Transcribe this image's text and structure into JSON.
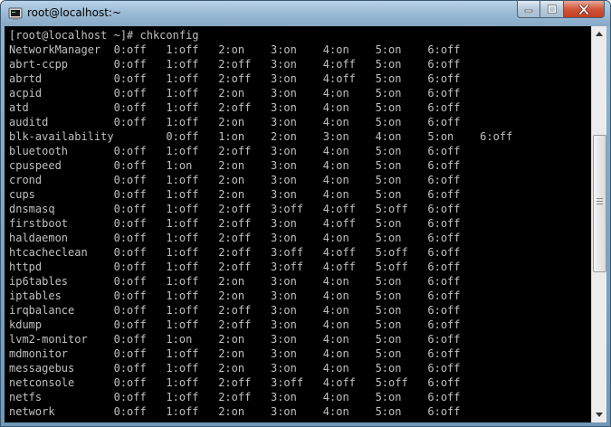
{
  "window": {
    "title": "root@localhost:~",
    "icon": "putty-terminal-icon"
  },
  "terminal": {
    "lines": [
      "[root@localhost ~]# chkconfig",
      "NetworkManager  0:off   1:off   2:on    3:on    4:on    5:on    6:off",
      "abrt-ccpp       0:off   1:off   2:off   3:on    4:off   5:on    6:off",
      "abrtd           0:off   1:off   2:off   3:on    4:off   5:on    6:off",
      "acpid           0:off   1:off   2:on    3:on    4:on    5:on    6:off",
      "atd             0:off   1:off   2:off   3:on    4:on    5:on    6:off",
      "auditd          0:off   1:off   2:on    3:on    4:on    5:on    6:off",
      "blk-availability        0:off   1:on    2:on    3:on    4:on    5:on    6:off",
      "bluetooth       0:off   1:off   2:off   3:on    4:on    5:on    6:off",
      "cpuspeed        0:off   1:on    2:on    3:on    4:on    5:on    6:off",
      "crond           0:off   1:off   2:on    3:on    4:on    5:on    6:off",
      "cups            0:off   1:off   2:on    3:on    4:on    5:on    6:off",
      "dnsmasq         0:off   1:off   2:off   3:off   4:off   5:off   6:off",
      "firstboot       0:off   1:off   2:off   3:on    4:off   5:on    6:off",
      "haldaemon       0:off   1:off   2:off   3:on    4:on    5:on    6:off",
      "htcacheclean    0:off   1:off   2:off   3:off   4:off   5:off   6:off",
      "httpd           0:off   1:off   2:off   3:off   4:off   5:off   6:off",
      "ip6tables       0:off   1:off   2:on    3:on    4:on    5:on    6:off",
      "iptables        0:off   1:off   2:on    3:on    4:on    5:on    6:off",
      "irqbalance      0:off   1:off   2:off   3:on    4:on    5:on    6:off",
      "kdump           0:off   1:off   2:off   3:on    4:on    5:on    6:off",
      "lvm2-monitor    0:off   1:on    2:on    3:on    4:on    5:on    6:off",
      "mdmonitor       0:off   1:off   2:on    3:on    4:on    5:on    6:off",
      "messagebus      0:off   1:off   2:on    3:on    4:on    5:on    6:off",
      "netconsole      0:off   1:off   2:off   3:off   4:off   5:off   6:off",
      "netfs           0:off   1:off   2:off   3:on    4:on    5:on    6:off",
      "network         0:off   1:off   2:on    3:on    4:on    5:on    6:off"
    ]
  },
  "colors": {
    "terminal_bg": "#000000",
    "terminal_fg": "#c0c0c0",
    "title_bar": "#9dbcd6",
    "close_button": "#d3553b"
  }
}
